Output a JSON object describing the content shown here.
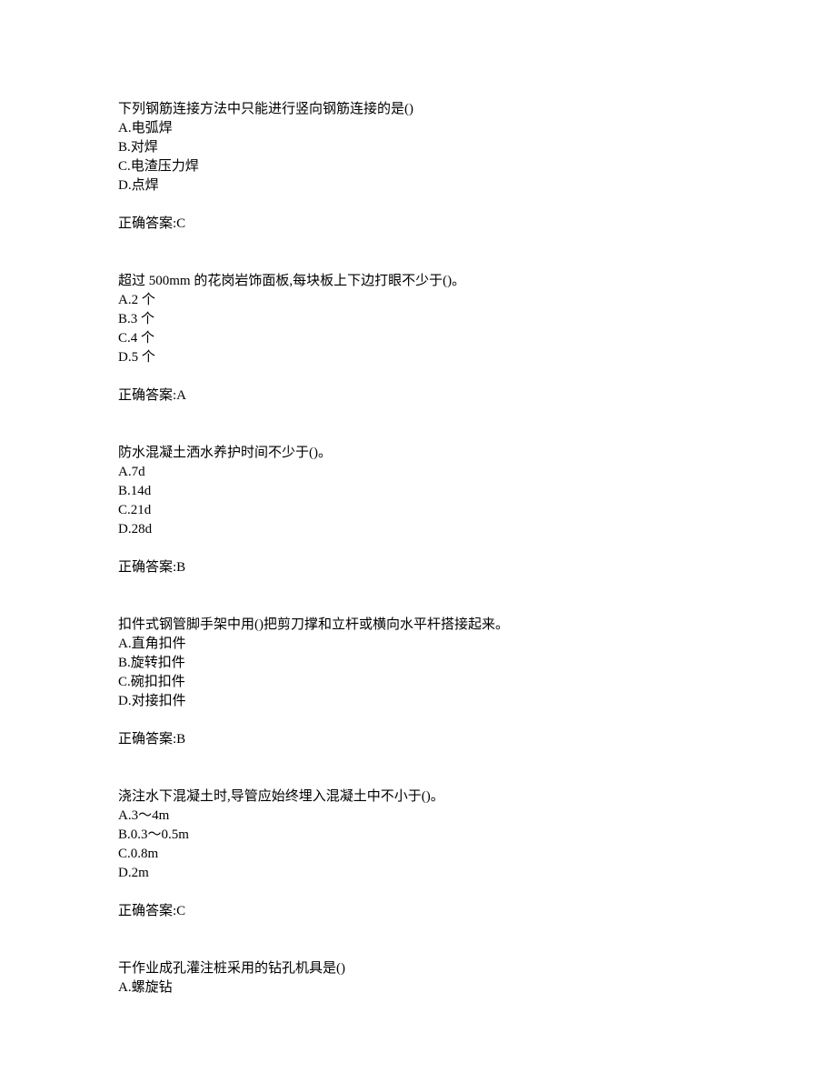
{
  "questions": [
    {
      "text": "下列钢筋连接方法中只能进行竖向钢筋连接的是()",
      "options": [
        "A.电弧焊",
        "B.对焊",
        "C.电渣压力焊",
        "D.点焊"
      ],
      "answer": "正确答案:C"
    },
    {
      "text": "超过 500mm 的花岗岩饰面板,每块板上下边打眼不少于()。",
      "options": [
        "A.2 个",
        "B.3 个",
        "C.4 个",
        "D.5 个"
      ],
      "answer": "正确答案:A"
    },
    {
      "text": "防水混凝土洒水养护时间不少于()。",
      "options": [
        "A.7d",
        "B.14d",
        "C.21d",
        "D.28d"
      ],
      "answer": "正确答案:B"
    },
    {
      "text": "扣件式钢管脚手架中用()把剪刀撑和立杆或横向水平杆搭接起来。",
      "options": [
        "A.直角扣件",
        "B.旋转扣件",
        "C.碗扣扣件",
        "D.对接扣件"
      ],
      "answer": "正确答案:B"
    },
    {
      "text": "浇注水下混凝土时,导管应始终埋入混凝土中不小于()。",
      "options": [
        "A.3～4m",
        "B.0.3～0.5m",
        "C.0.8m",
        "D.2m"
      ],
      "answer": "正确答案:C"
    },
    {
      "text": "干作业成孔灌注桩采用的钻孔机具是()",
      "options": [
        "A.螺旋钻"
      ],
      "answer": ""
    }
  ]
}
